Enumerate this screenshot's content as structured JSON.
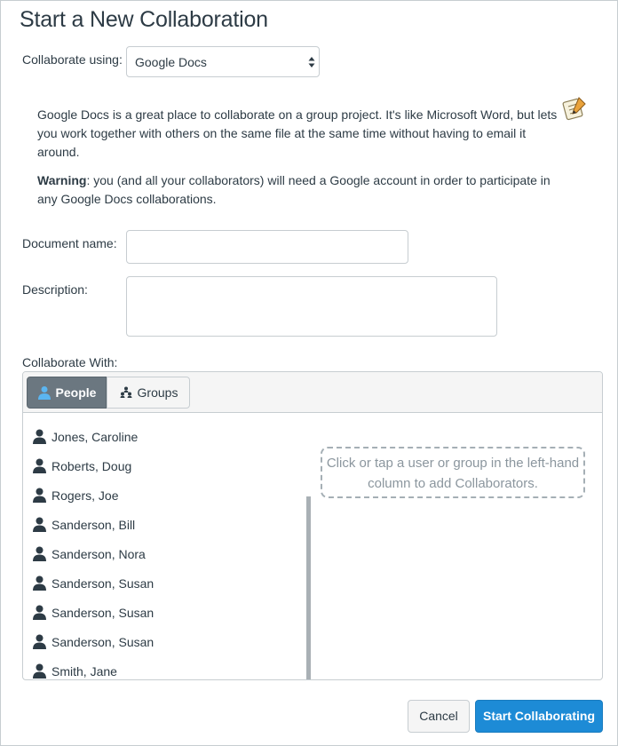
{
  "page": {
    "title": "Start a New Collaboration"
  },
  "form": {
    "collaborate_using_label": "Collaborate using:",
    "service_selected": "Google Docs",
    "service_description": "Google Docs is a great place to collaborate on a group project. It's like Microsoft Word, but lets you work together with others on the same file at the same time without having to email it around.",
    "warning_label": "Warning",
    "warning_text": ": you (and all your collaborators) will need a Google account in order to participate in any Google Docs collaborations.",
    "document_name_label": "Document name:",
    "document_name_value": "",
    "description_label": "Description:",
    "description_value": "",
    "collaborate_with_label": "Collaborate With:"
  },
  "tabs": {
    "people": "People",
    "groups": "Groups",
    "active": "people"
  },
  "users": [
    "Jones, Caroline",
    "Roberts, Doug",
    "Rogers, Joe",
    "Sanderson, Bill",
    "Sanderson, Nora",
    "Sanderson, Susan",
    "Sanderson, Susan",
    "Sanderson, Susan",
    "Smith, Jane"
  ],
  "hint_text": "Click or tap a user or group in the left-hand column to add Collaborators.",
  "buttons": {
    "cancel": "Cancel",
    "start": "Start Collaborating"
  },
  "colors": {
    "primary": "#1d8bd6",
    "active_tab": "#6b7780",
    "text": "#2d3b45"
  },
  "icons": {
    "info": "document-pencil-icon",
    "people_tab": "person-icon",
    "groups_tab": "group-icon",
    "user": "user-silhouette-icon"
  }
}
